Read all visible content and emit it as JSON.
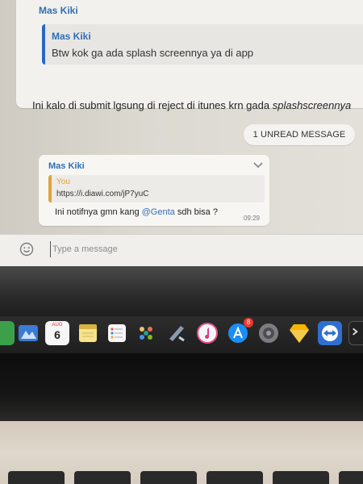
{
  "top_message": {
    "sender": "Mas Kiki",
    "quote_sender": "Mas Kiki",
    "quote_text": "Btw kok ga ada splash screennya ya di app",
    "body_prefix": "Ini kalo di submit lgsung di reject di itunes krn gada ",
    "body_italic": "splashscreennya"
  },
  "unread_badge": "1 UNREAD MESSAGE",
  "message": {
    "sender": "Mas Kiki",
    "quote_sender": "You",
    "quote_text": "https://i.diawi.com/jP7yuC",
    "body_prefix": "Ini notifnya gmn kang ",
    "mention": "@Genta",
    "body_suffix": " sdh bisa ?",
    "time": "09:29"
  },
  "composer": {
    "placeholder": "Type a message"
  },
  "dock": {
    "calendar_month": "AUG",
    "calendar_day": "6",
    "appstore_badge": "8",
    "icons": [
      "finder-icon",
      "image-capture-icon",
      "calendar-icon",
      "notes-icon",
      "reminders-icon",
      "photos-icon",
      "xcode-icon",
      "itunes-icon",
      "app-store-icon",
      "system-preferences-icon",
      "sketch-icon",
      "teamviewer-icon",
      "terminal-icon"
    ]
  },
  "colors": {
    "accent_blue": "#2f6fb6",
    "quote_yellow": "#e0a23d",
    "quote_blue_bar": "#2a67c4",
    "badge_red": "#e83a32"
  }
}
